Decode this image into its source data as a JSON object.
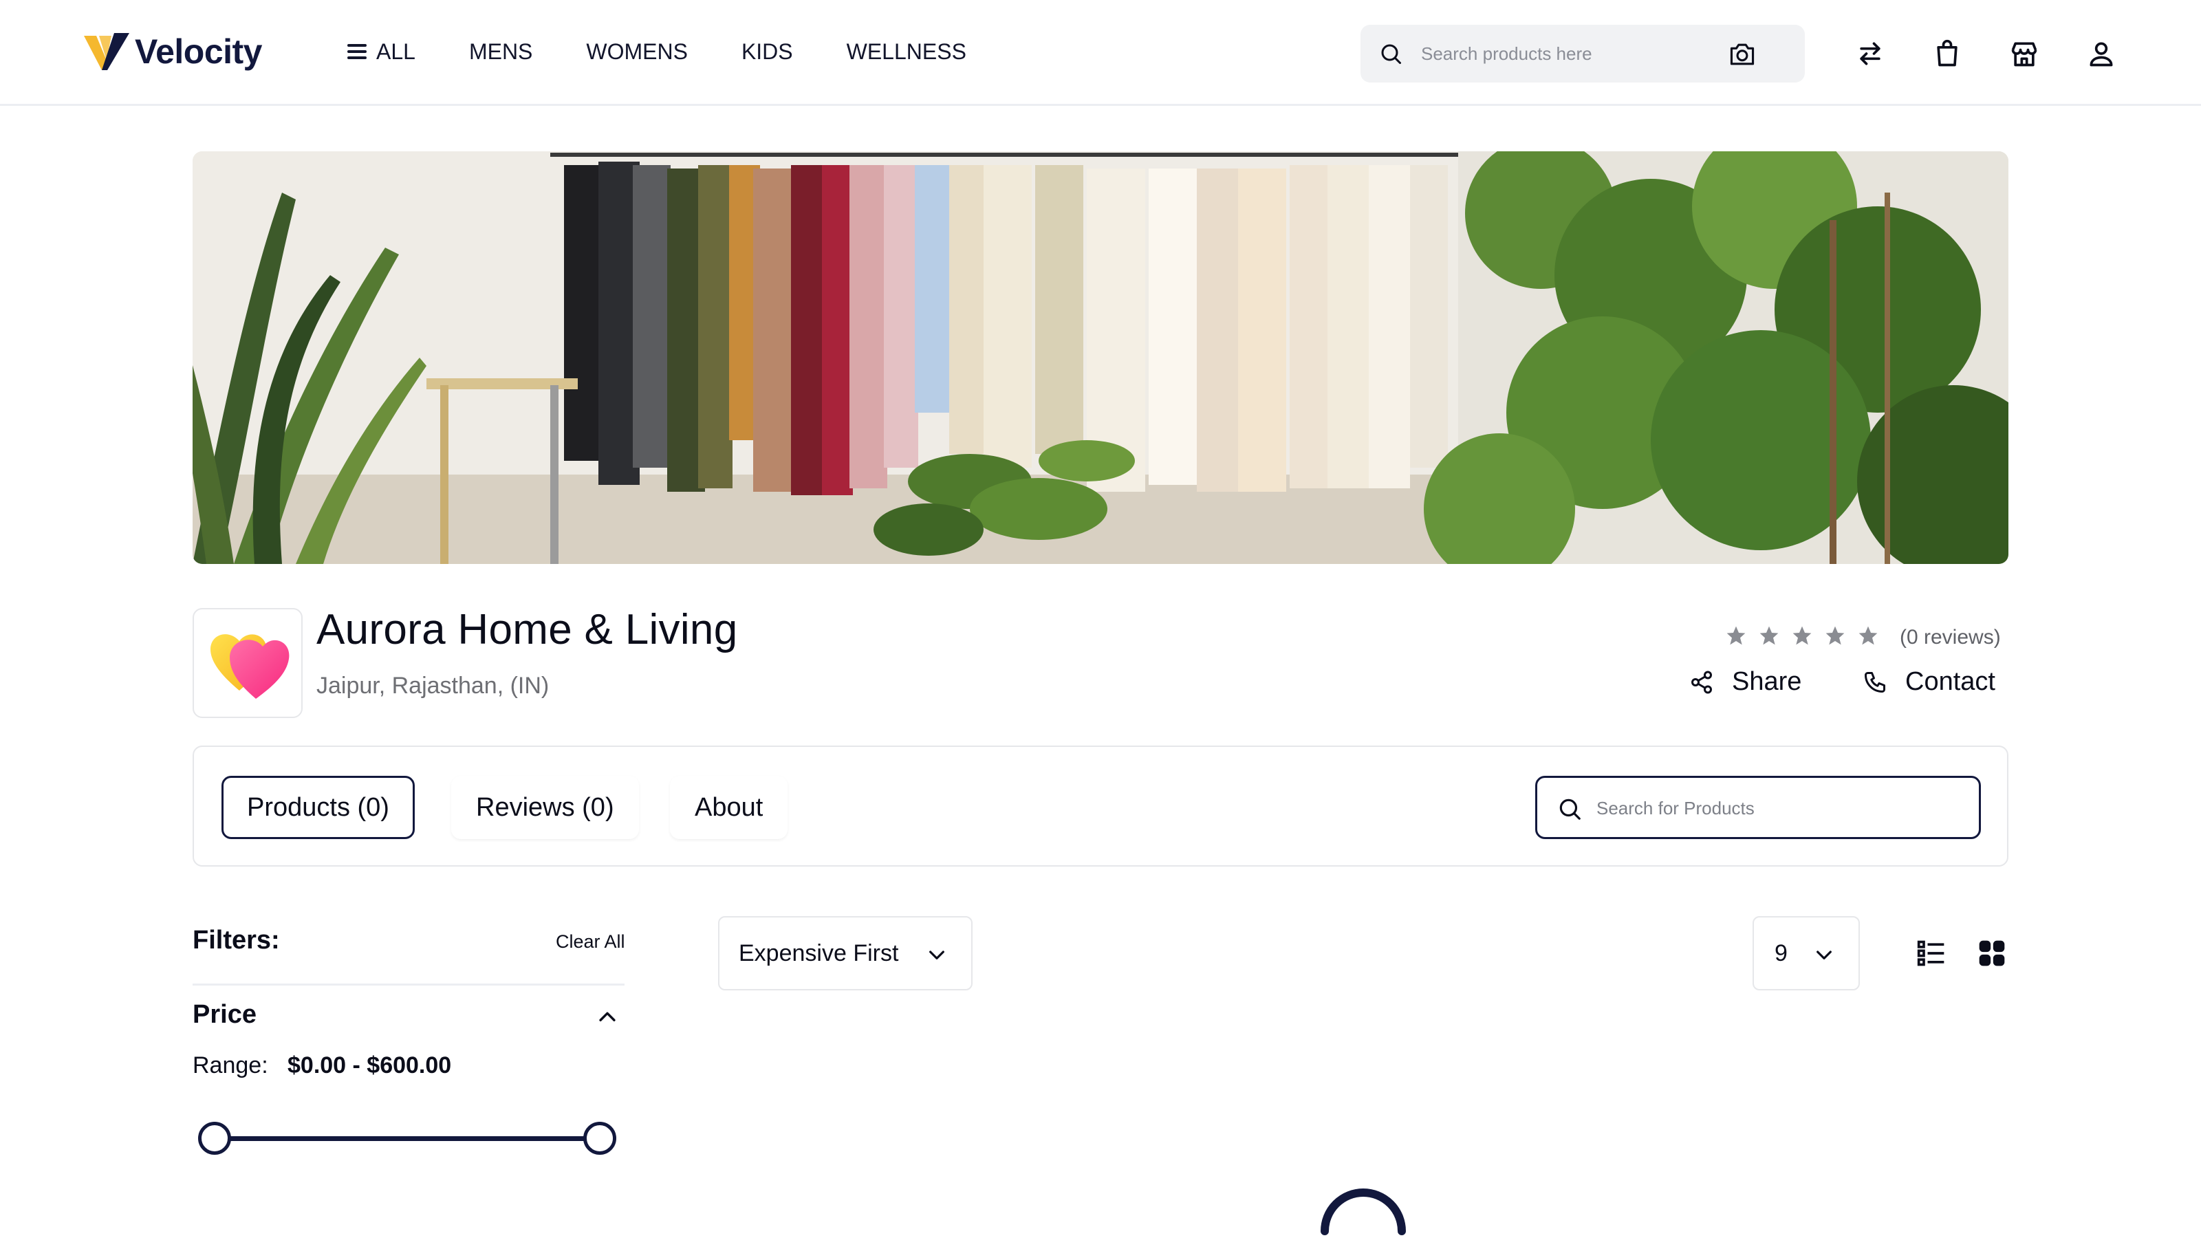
{
  "brand": {
    "name": "Velocity"
  },
  "nav": {
    "all": "ALL",
    "mens": "MENS",
    "womens": "WOMENS",
    "kids": "KIDS",
    "wellness": "WELLNESS"
  },
  "search": {
    "placeholder": "Search products here"
  },
  "header_icons": [
    "camera-icon",
    "compare-icon",
    "shopping-bag-icon",
    "store-icon",
    "user-icon"
  ],
  "store": {
    "name": "Aurora Home & Living",
    "location": "Jaipur, Rajasthan, (IN)",
    "reviews_count": "(0 reviews)",
    "rating": 0,
    "share_label": "Share",
    "contact_label": "Contact"
  },
  "tabs": [
    {
      "label": "Products (0)"
    },
    {
      "label": "Reviews (0)"
    },
    {
      "label": "About"
    }
  ],
  "product_search": {
    "placeholder": "Search for Products"
  },
  "filters": {
    "title": "Filters:",
    "clear_label": "Clear All",
    "price": {
      "title": "Price",
      "range_label": "Range:",
      "range_value": "$0.00 - $600.00"
    }
  },
  "toolbar": {
    "sort": "Expensive First",
    "per_page": "9"
  },
  "colors": {
    "primary": "#12183d",
    "accent_gold": "#f5b82e",
    "border": "#e6e7ea"
  }
}
